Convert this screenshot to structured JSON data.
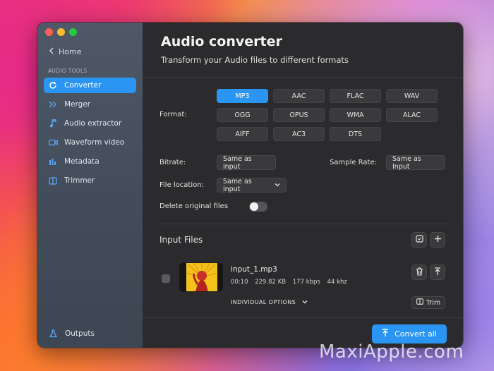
{
  "sidebar": {
    "home_label": "Home",
    "section_label": "AUDIO TOOLS",
    "items": [
      {
        "label": "Converter",
        "icon": "refresh-icon"
      },
      {
        "label": "Merger",
        "icon": "merge-arrows-icon"
      },
      {
        "label": "Audio extractor",
        "icon": "music-note-icon"
      },
      {
        "label": "Waveform video",
        "icon": "video-camera-icon"
      },
      {
        "label": "Metadata",
        "icon": "metadata-bars-icon"
      },
      {
        "label": "Trimmer",
        "icon": "trim-icon"
      }
    ],
    "active_item": "Converter",
    "outputs_label": "Outputs"
  },
  "header": {
    "title": "Audio converter",
    "subtitle": "Transform your Audio files to different formats"
  },
  "format": {
    "label": "Format:",
    "options": [
      "MP3",
      "AAC",
      "FLAC",
      "WAV",
      "OGG",
      "OPUS",
      "WMA",
      "ALAC",
      "AIFF",
      "AC3",
      "DTS"
    ],
    "selected": "MP3"
  },
  "bitrate": {
    "label": "Bitrate:",
    "value": "Same as input"
  },
  "sample_rate": {
    "label": "Sample Rate:",
    "value": "Same as Input"
  },
  "file_location": {
    "label": "File location:",
    "value": "Same as input"
  },
  "delete_original": {
    "label": "Delete original files",
    "enabled": false
  },
  "input_files": {
    "title": "Input Files",
    "files": [
      {
        "name": "input_1.mp3",
        "duration": "00:10",
        "size": "229.82 KB",
        "bitrate": "177 kbps",
        "sample_rate": "44 khz",
        "individual_options_label": "INDIVIDUAL OPTIONS",
        "trim_label": "Trim"
      }
    ]
  },
  "convert_all_label": "Convert all",
  "watermark": "MaxiApple.com",
  "colors": {
    "accent": "#2a95f2",
    "main_bg": "#2b2b2d",
    "sidebar_bg": "#4b5563"
  }
}
